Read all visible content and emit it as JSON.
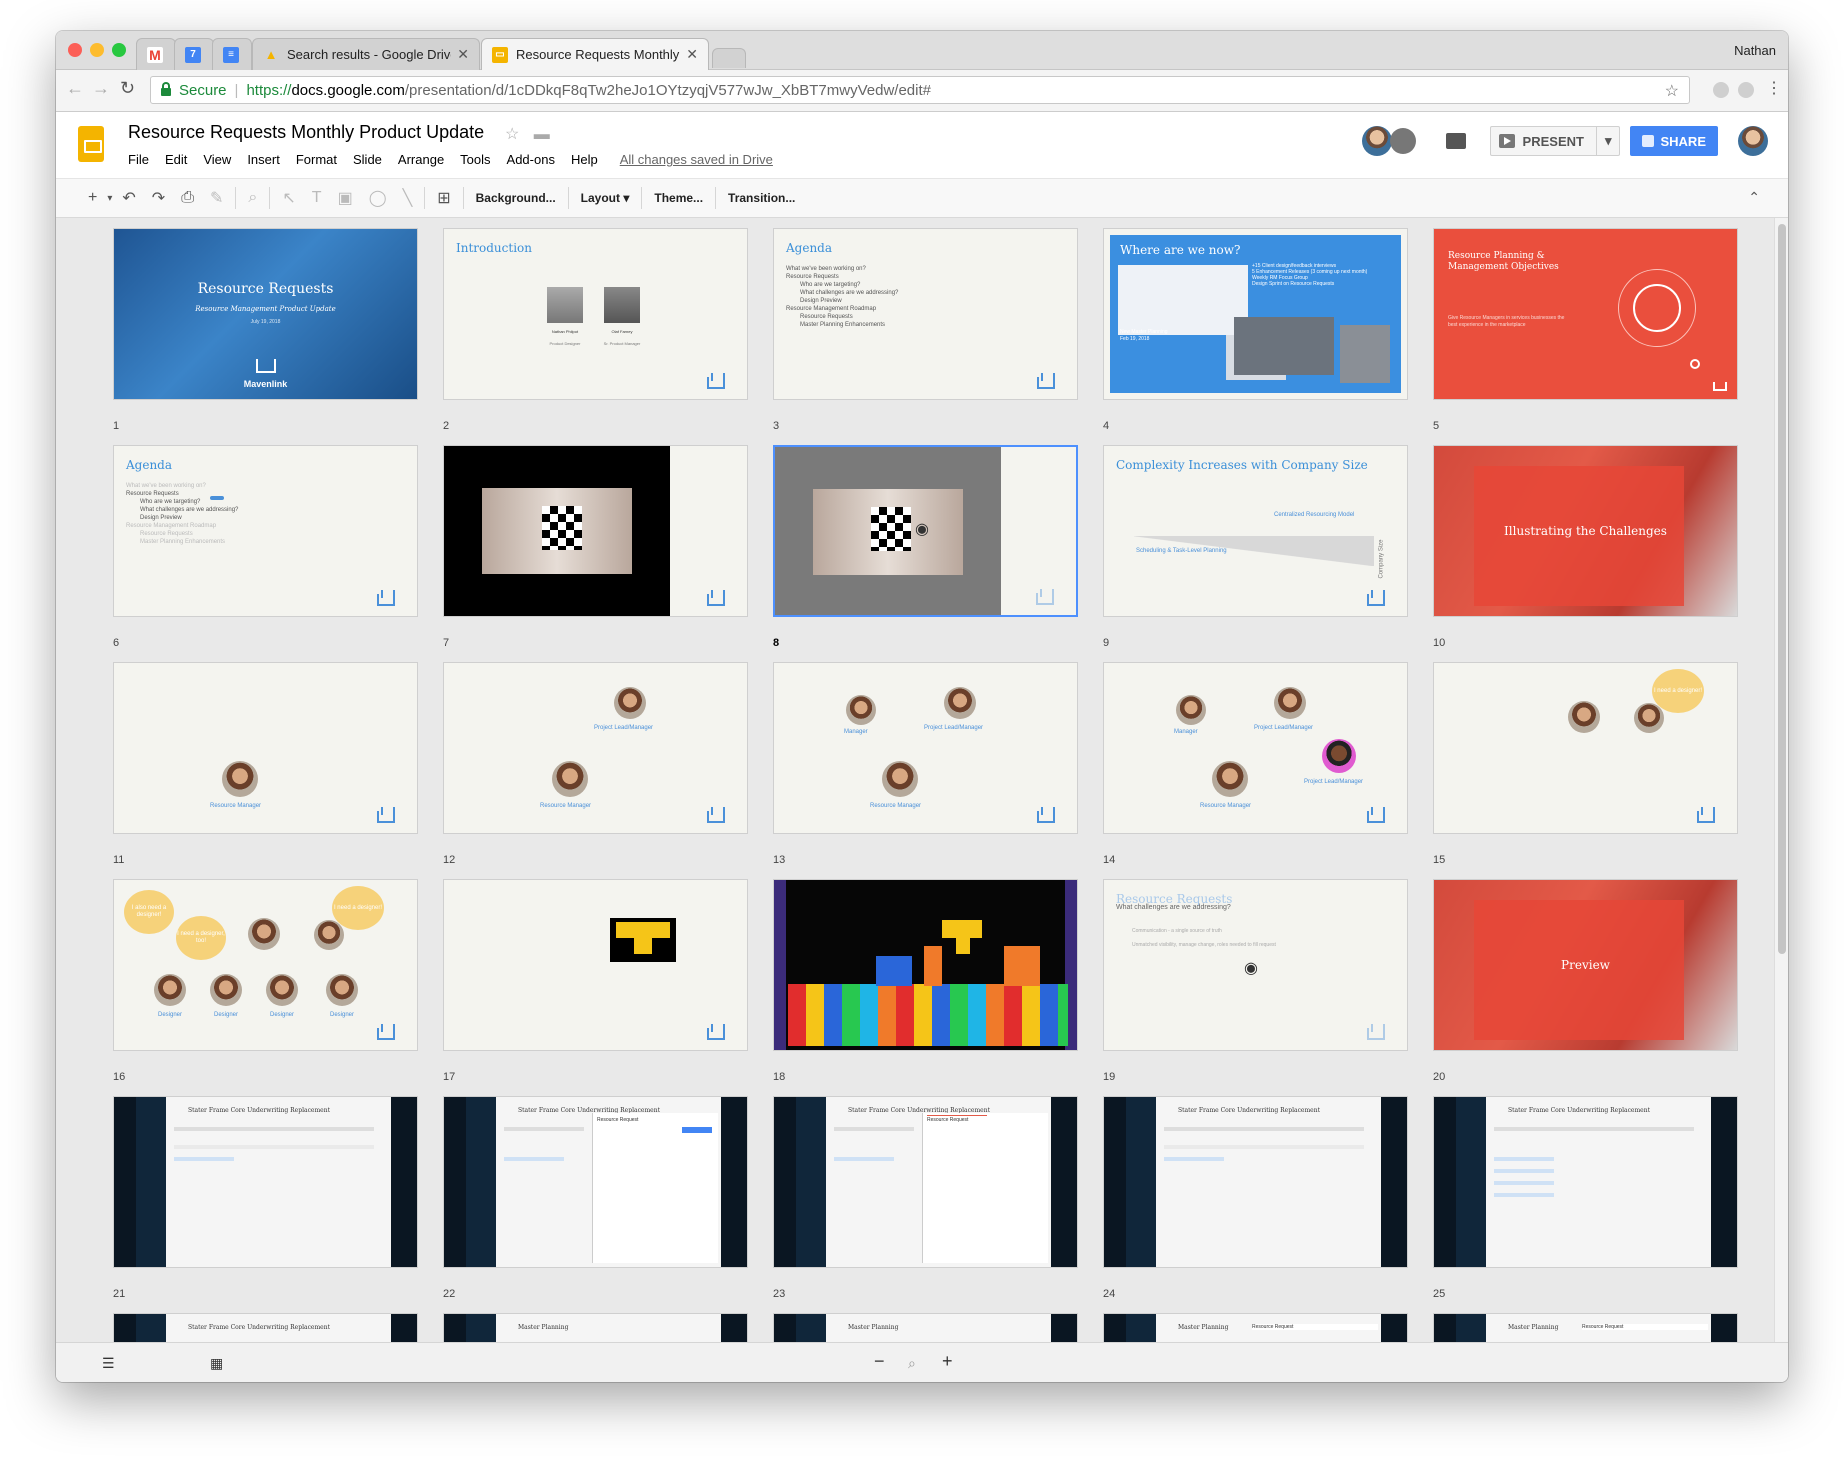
{
  "browser": {
    "user": "Nathan",
    "tabs": [
      {
        "label": "",
        "icon": "gmail-icon",
        "color": "#ea4335",
        "glyph": "M"
      },
      {
        "label": "",
        "icon": "calendar-icon",
        "color": "#4285f4",
        "glyph": "7"
      },
      {
        "label": "",
        "icon": "docs-icon",
        "color": "#4285f4",
        "glyph": "≡"
      },
      {
        "label": "Search results - Google Drive",
        "icon": "drive-icon",
        "color": "#f4b400",
        "glyph": "▲"
      },
      {
        "label": "Resource Requests Monthly Product Update",
        "icon": "slides-icon",
        "color": "#f4b400",
        "glyph": "▭"
      }
    ],
    "secure_label": "Secure",
    "url_scheme": "https://",
    "url_host": "docs.google.com",
    "url_path": "/presentation/d/1cDDkqF8qTw2heJo1OYtzyqjV577wJw_XbBT7mwyVedw/edit#"
  },
  "doc": {
    "title": "Resource Requests Monthly Product Update",
    "menu": [
      "File",
      "Edit",
      "View",
      "Insert",
      "Format",
      "Slide",
      "Arrange",
      "Tools",
      "Add-ons",
      "Help"
    ],
    "saved_status": "All changes saved in Drive",
    "present_label": "PRESENT",
    "share_label": "SHARE"
  },
  "toolbar": {
    "background": "Background...",
    "layout": "Layout",
    "theme": "Theme...",
    "transition": "Transition..."
  },
  "slides": {
    "s1": {
      "num": "1",
      "title": "Resource Requests",
      "sub": "Resource Management Product Update",
      "date": "July 19, 2018",
      "brand": "Mavenlink"
    },
    "s2": {
      "num": "2",
      "title": "Introduction",
      "p1": "Nathan Philpot",
      "p1r": "Product Designer",
      "p2": "Olaf Farney",
      "p2r": "Sr. Product Manager"
    },
    "s3": {
      "num": "3",
      "title": "Agenda",
      "b": [
        "What we've been working on?",
        "Resource Requests",
        "Who are we targeting?",
        "What challenges are we addressing?",
        "Design Preview",
        "Resource Management Roadmap",
        "Resource Requests",
        "Master Planning Enhancements"
      ]
    },
    "s4": {
      "num": "4",
      "title": "Where are we now?",
      "caption": "New Master Planning",
      "caption_date": "Feb 19, 2018",
      "list": [
        "+15 Client design/feedback interviews",
        "5 Enhancement Releases (3 coming up next month)",
        "Weekly RM Focus Group",
        "Design Sprint on Resource Requests"
      ]
    },
    "s5": {
      "num": "5",
      "title": "Resource Planning & Management Objectives",
      "body": "Give Resource Managers in services businesses the best experience in the marketplace"
    },
    "s6": {
      "num": "6",
      "title": "Agenda",
      "b": [
        "What we've been working on?",
        "Resource Requests",
        "Who are we targeting?",
        "What challenges are we addressing?",
        "Design Preview",
        "Resource Management Roadmap",
        "Resource Requests",
        "Master Planning Enhancements"
      ]
    },
    "s7": {
      "num": "7"
    },
    "s8": {
      "num": "8"
    },
    "s9": {
      "num": "9",
      "title": "Complexity Increases with Company Size",
      "left": "Scheduling & Task-Level Planning",
      "right": "Centralized Resourcing Model",
      "axis": "Company Size"
    },
    "s10": {
      "num": "10",
      "title": "Illustrating the Challenges"
    },
    "s11": {
      "num": "11",
      "label": "Resource Manager"
    },
    "s12": {
      "num": "12",
      "label1": "Project Lead/Manager",
      "label2": "Resource Manager"
    },
    "s13": {
      "num": "13",
      "label0": "Manager",
      "label1": "Project Lead/Manager",
      "label2": "Resource Manager"
    },
    "s14": {
      "num": "14",
      "label0": "Manager",
      "label1": "Project Lead/Manager",
      "label2": "Resource Manager",
      "label3": "Project Lead/Manager"
    },
    "s15": {
      "num": "15",
      "bubble": "I need a designer!"
    },
    "s16": {
      "num": "16",
      "bubble1": "I also need a designer!",
      "bubble2": "I need a designer, too!",
      "bubble3": "I need a designer!",
      "role": "Designer"
    },
    "s17": {
      "num": "17"
    },
    "s18": {
      "num": "18"
    },
    "s19": {
      "num": "19",
      "title": "Resource Requests",
      "sub": "What challenges are we addressing?",
      "b1": "Communication - a single source of truth",
      "b2": "Unmatched visibility, manage change, roles needed to fill request"
    },
    "s20": {
      "num": "20",
      "title": "Preview"
    },
    "s21": {
      "num": "21",
      "head": "Stater Frame Core Underwriting Replacement"
    },
    "s22": {
      "num": "22",
      "head": "Stater Frame Core Underwriting Replacement",
      "panel": "Resource Request"
    },
    "s23": {
      "num": "23",
      "head": "Stater Frame Core Underwriting Replacement",
      "panel": "Resource Request"
    },
    "s24": {
      "num": "24",
      "head": "Stater Frame Core Underwriting Replacement"
    },
    "s25": {
      "num": "25",
      "head": "Stater Frame Core Underwriting Replacement"
    },
    "s26": {
      "head": "Stater Frame Core Underwriting Replacement"
    },
    "s27": {
      "head": "Master Planning"
    },
    "s28": {
      "head": "Master Planning"
    },
    "s29": {
      "head": "Master Planning",
      "panel": "Resource Request"
    },
    "s30": {
      "head": "Master Planning",
      "panel": "Resource Request"
    }
  },
  "colors": {
    "accent": "#4285f4",
    "slides_yellow": "#f4b400",
    "mavenlink_blue": "#3a8fd8",
    "red": "#ea4f3d"
  }
}
